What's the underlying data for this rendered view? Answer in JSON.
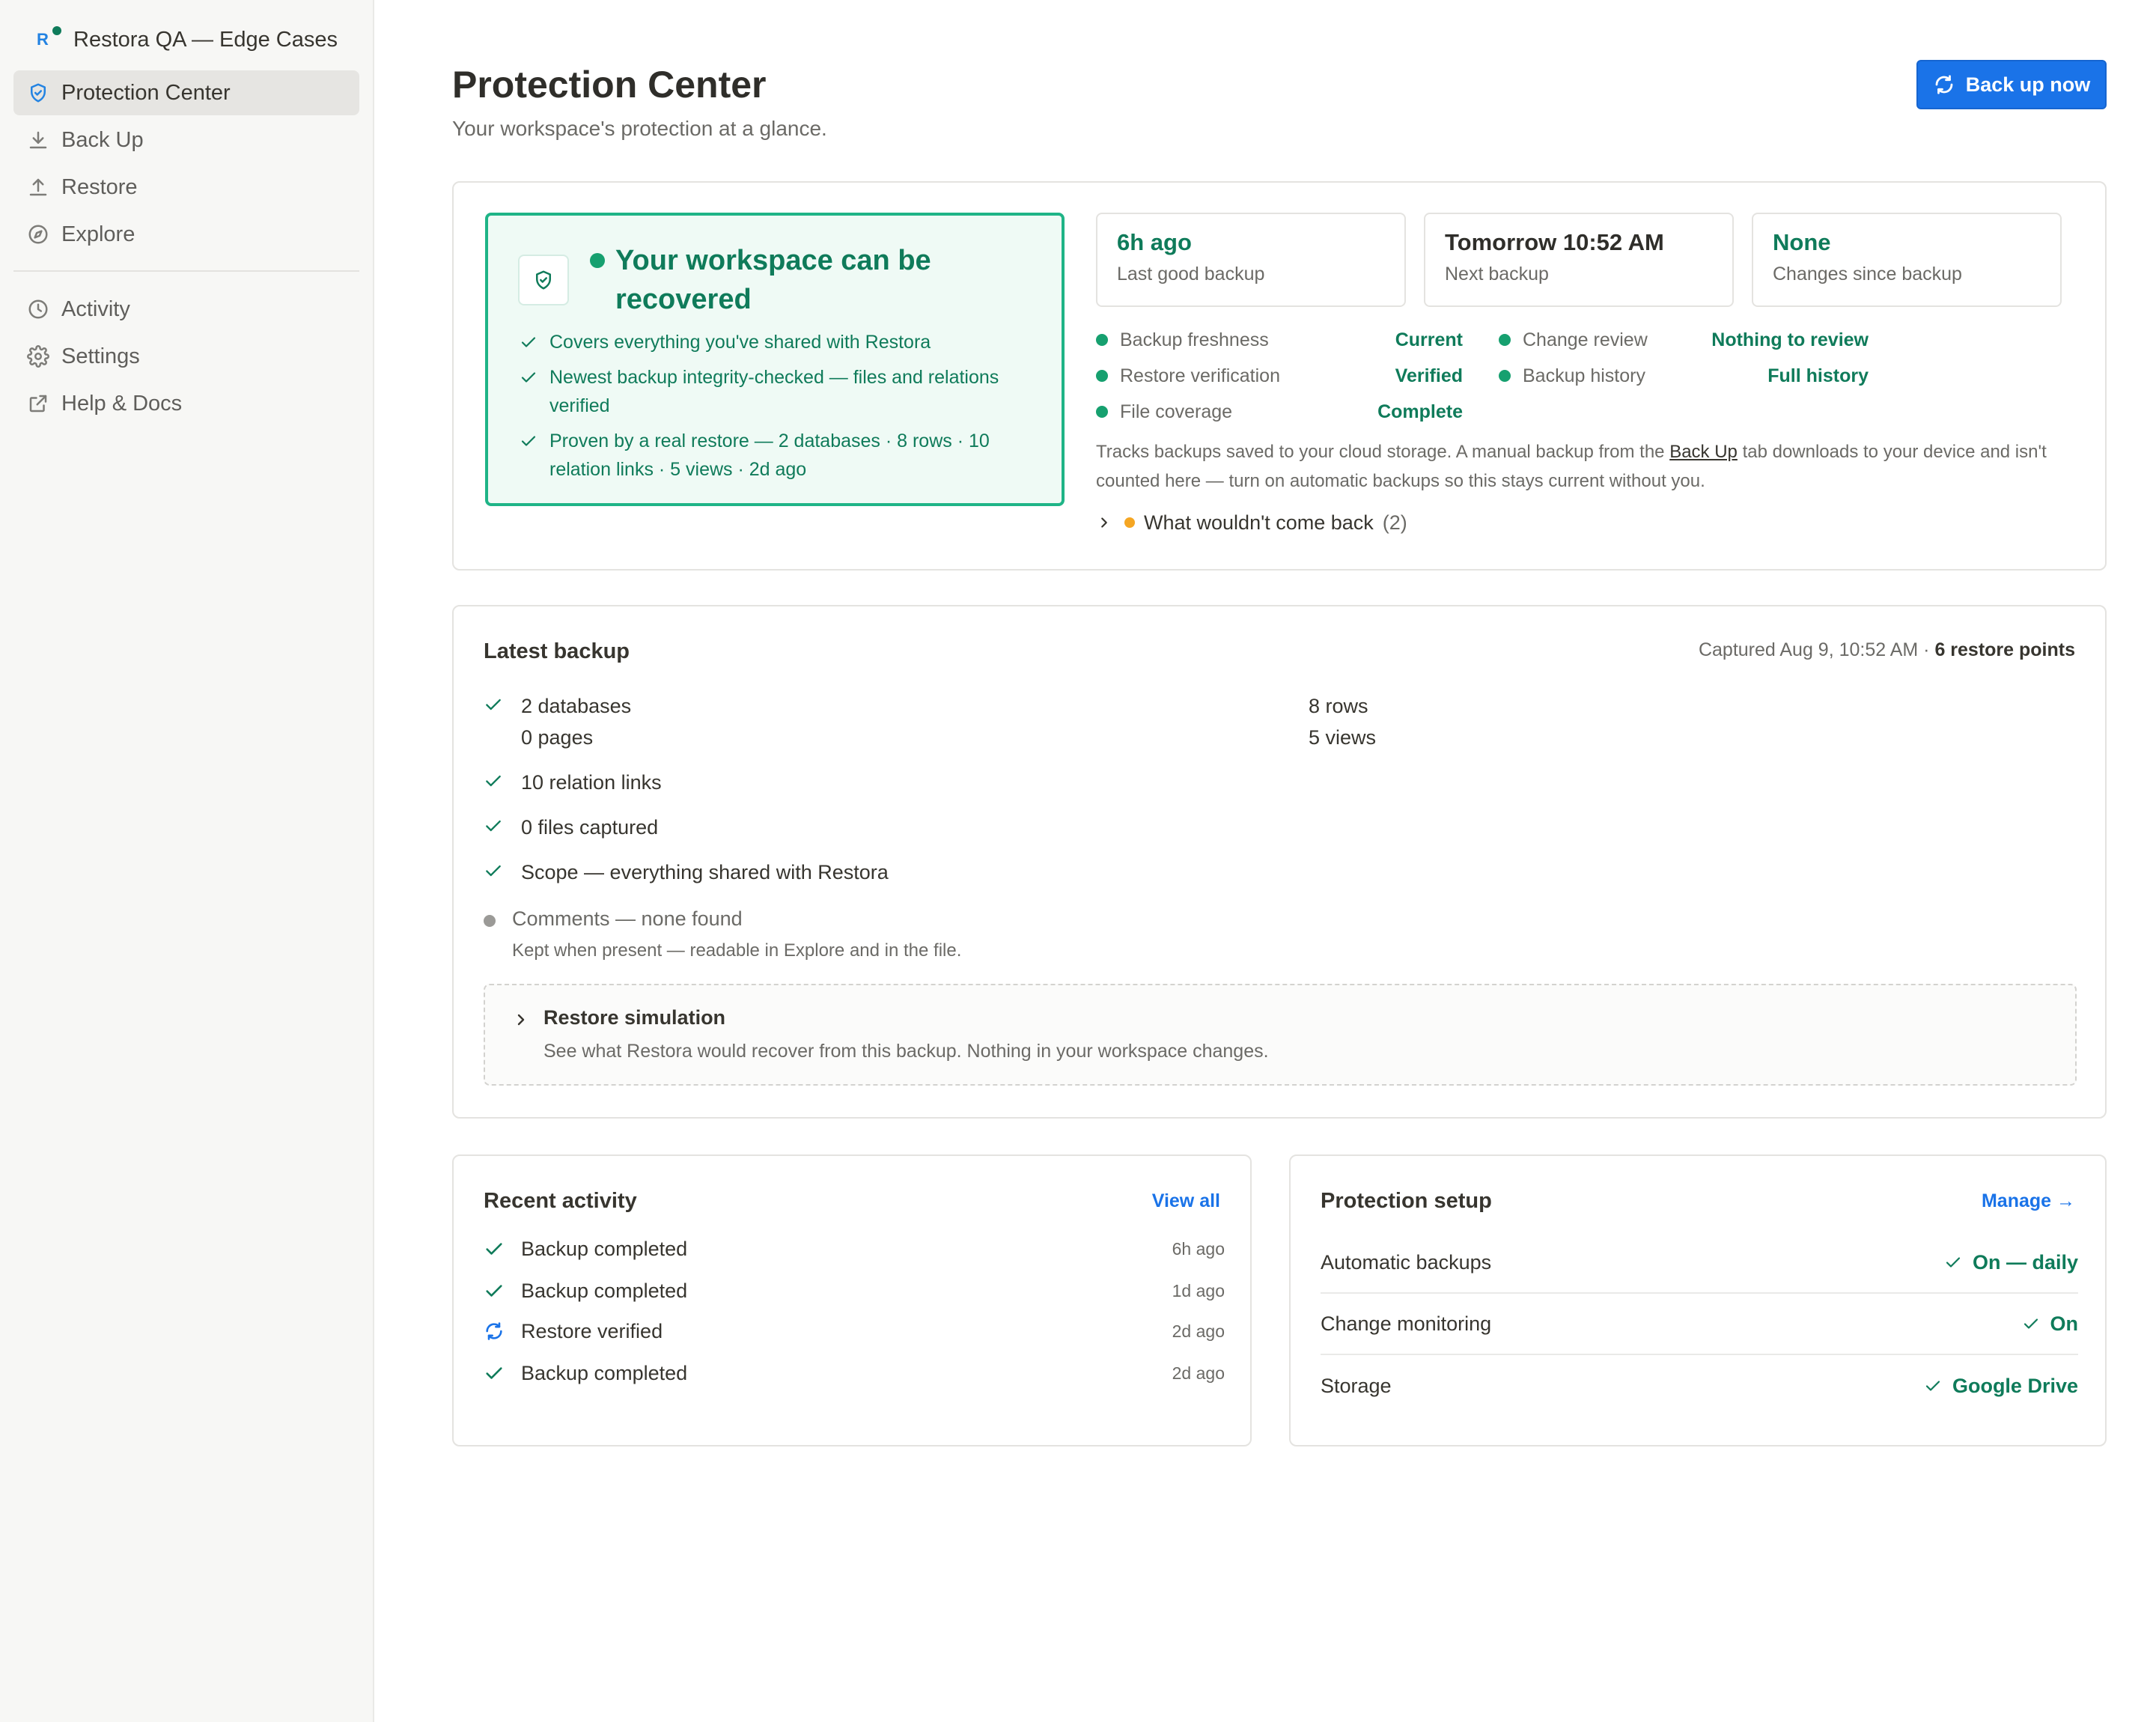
{
  "workspace": {
    "name": "Restora QA — Edge Cases",
    "logo_letter": "R"
  },
  "sidebar": {
    "primary": [
      {
        "label": "Protection Center",
        "icon": "shield-icon",
        "active": true
      },
      {
        "label": "Back Up",
        "icon": "download-icon"
      },
      {
        "label": "Restore",
        "icon": "upload-icon"
      },
      {
        "label": "Explore",
        "icon": "compass-icon"
      }
    ],
    "secondary": [
      {
        "label": "Activity",
        "icon": "clock-icon"
      },
      {
        "label": "Settings",
        "icon": "gear-icon"
      },
      {
        "label": "Help & Docs",
        "icon": "external-link-icon"
      }
    ]
  },
  "header": {
    "title": "Protection Center",
    "subtitle": "Your workspace's protection at a glance.",
    "backup_button": "Back up now"
  },
  "status": {
    "headline": "Your workspace can be recovered",
    "checks": [
      "Covers everything you've shared with Restora",
      "Newest backup integrity-checked — files and relations verified",
      "Proven by a real restore — 2 databases · 8 rows · 10 relation links · 5 views · 2d ago"
    ],
    "tiles": [
      {
        "value": "6h ago",
        "label": "Last good backup"
      },
      {
        "value": "Tomorrow 10:52 AM",
        "label": "Next backup"
      },
      {
        "value": "None",
        "label": "Changes since backup"
      }
    ],
    "criteria_left": [
      {
        "label": "Backup freshness",
        "value": "Current"
      },
      {
        "label": "Restore verification",
        "value": "Verified"
      },
      {
        "label": "File coverage",
        "value": "Complete"
      }
    ],
    "criteria_right": [
      {
        "label": "Change review",
        "value": "Nothing to review"
      },
      {
        "label": "Backup history",
        "value": "Full history"
      }
    ],
    "note_before": "Tracks backups saved to your cloud storage. A manual backup from the",
    "note_link": "Back Up",
    "note_after": "tab downloads to your device and isn't counted here — turn on automatic backups so this stays current without you.",
    "gaps_label": "What wouldn't come back",
    "gaps_count": "(2)"
  },
  "latest_backup": {
    "title": "Latest backup",
    "captured": "Captured Aug 9, 10:52 AM · ",
    "restore_points": "6 restore points",
    "databases": "2 databases",
    "pages": "0 pages",
    "rows": "8 rows",
    "views": "5 views",
    "relation_links": "10 relation links",
    "files": "0 files captured",
    "scope": "Scope — everything shared with Restora",
    "comments": "Comments — none found",
    "comments_note": "Kept when present — readable in Explore and in the file.",
    "simulation_title": "Restore simulation",
    "simulation_desc": "See what Restora would recover from this backup. Nothing in your workspace changes."
  },
  "activity": {
    "title": "Recent activity",
    "view_all": "View all",
    "items": [
      {
        "label": "Backup completed",
        "time": "6h ago",
        "icon": "check-icon"
      },
      {
        "label": "Backup completed",
        "time": "1d ago",
        "icon": "check-icon"
      },
      {
        "label": "Restore verified",
        "time": "2d ago",
        "icon": "refresh-icon"
      },
      {
        "label": "Backup completed",
        "time": "2d ago",
        "icon": "check-icon"
      }
    ]
  },
  "setup": {
    "title": "Protection setup",
    "manage": "Manage →",
    "rows": [
      {
        "label": "Automatic backups",
        "value": "On — daily"
      },
      {
        "label": "Change monitoring",
        "value": "On"
      },
      {
        "label": "Storage",
        "value": "Google Drive"
      }
    ]
  },
  "colors": {
    "accent": "#1a73e8",
    "success": "#0f7b5a",
    "success_border": "#1fb487",
    "warning": "#f5a623"
  }
}
